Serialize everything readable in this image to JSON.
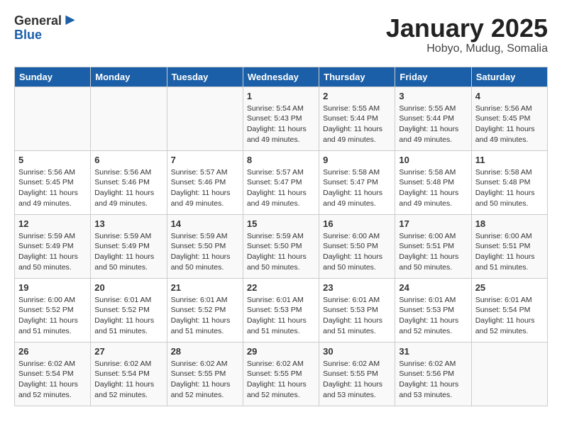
{
  "logo": {
    "general": "General",
    "blue": "Blue"
  },
  "title": "January 2025",
  "location": "Hobyo, Mudug, Somalia",
  "weekdays": [
    "Sunday",
    "Monday",
    "Tuesday",
    "Wednesday",
    "Thursday",
    "Friday",
    "Saturday"
  ],
  "weeks": [
    [
      {
        "day": "",
        "info": ""
      },
      {
        "day": "",
        "info": ""
      },
      {
        "day": "",
        "info": ""
      },
      {
        "day": "1",
        "info": "Sunrise: 5:54 AM\nSunset: 5:43 PM\nDaylight: 11 hours\nand 49 minutes."
      },
      {
        "day": "2",
        "info": "Sunrise: 5:55 AM\nSunset: 5:44 PM\nDaylight: 11 hours\nand 49 minutes."
      },
      {
        "day": "3",
        "info": "Sunrise: 5:55 AM\nSunset: 5:44 PM\nDaylight: 11 hours\nand 49 minutes."
      },
      {
        "day": "4",
        "info": "Sunrise: 5:56 AM\nSunset: 5:45 PM\nDaylight: 11 hours\nand 49 minutes."
      }
    ],
    [
      {
        "day": "5",
        "info": "Sunrise: 5:56 AM\nSunset: 5:45 PM\nDaylight: 11 hours\nand 49 minutes."
      },
      {
        "day": "6",
        "info": "Sunrise: 5:56 AM\nSunset: 5:46 PM\nDaylight: 11 hours\nand 49 minutes."
      },
      {
        "day": "7",
        "info": "Sunrise: 5:57 AM\nSunset: 5:46 PM\nDaylight: 11 hours\nand 49 minutes."
      },
      {
        "day": "8",
        "info": "Sunrise: 5:57 AM\nSunset: 5:47 PM\nDaylight: 11 hours\nand 49 minutes."
      },
      {
        "day": "9",
        "info": "Sunrise: 5:58 AM\nSunset: 5:47 PM\nDaylight: 11 hours\nand 49 minutes."
      },
      {
        "day": "10",
        "info": "Sunrise: 5:58 AM\nSunset: 5:48 PM\nDaylight: 11 hours\nand 49 minutes."
      },
      {
        "day": "11",
        "info": "Sunrise: 5:58 AM\nSunset: 5:48 PM\nDaylight: 11 hours\nand 50 minutes."
      }
    ],
    [
      {
        "day": "12",
        "info": "Sunrise: 5:59 AM\nSunset: 5:49 PM\nDaylight: 11 hours\nand 50 minutes."
      },
      {
        "day": "13",
        "info": "Sunrise: 5:59 AM\nSunset: 5:49 PM\nDaylight: 11 hours\nand 50 minutes."
      },
      {
        "day": "14",
        "info": "Sunrise: 5:59 AM\nSunset: 5:50 PM\nDaylight: 11 hours\nand 50 minutes."
      },
      {
        "day": "15",
        "info": "Sunrise: 5:59 AM\nSunset: 5:50 PM\nDaylight: 11 hours\nand 50 minutes."
      },
      {
        "day": "16",
        "info": "Sunrise: 6:00 AM\nSunset: 5:50 PM\nDaylight: 11 hours\nand 50 minutes."
      },
      {
        "day": "17",
        "info": "Sunrise: 6:00 AM\nSunset: 5:51 PM\nDaylight: 11 hours\nand 50 minutes."
      },
      {
        "day": "18",
        "info": "Sunrise: 6:00 AM\nSunset: 5:51 PM\nDaylight: 11 hours\nand 51 minutes."
      }
    ],
    [
      {
        "day": "19",
        "info": "Sunrise: 6:00 AM\nSunset: 5:52 PM\nDaylight: 11 hours\nand 51 minutes."
      },
      {
        "day": "20",
        "info": "Sunrise: 6:01 AM\nSunset: 5:52 PM\nDaylight: 11 hours\nand 51 minutes."
      },
      {
        "day": "21",
        "info": "Sunrise: 6:01 AM\nSunset: 5:52 PM\nDaylight: 11 hours\nand 51 minutes."
      },
      {
        "day": "22",
        "info": "Sunrise: 6:01 AM\nSunset: 5:53 PM\nDaylight: 11 hours\nand 51 minutes."
      },
      {
        "day": "23",
        "info": "Sunrise: 6:01 AM\nSunset: 5:53 PM\nDaylight: 11 hours\nand 51 minutes."
      },
      {
        "day": "24",
        "info": "Sunrise: 6:01 AM\nSunset: 5:53 PM\nDaylight: 11 hours\nand 52 minutes."
      },
      {
        "day": "25",
        "info": "Sunrise: 6:01 AM\nSunset: 5:54 PM\nDaylight: 11 hours\nand 52 minutes."
      }
    ],
    [
      {
        "day": "26",
        "info": "Sunrise: 6:02 AM\nSunset: 5:54 PM\nDaylight: 11 hours\nand 52 minutes."
      },
      {
        "day": "27",
        "info": "Sunrise: 6:02 AM\nSunset: 5:54 PM\nDaylight: 11 hours\nand 52 minutes."
      },
      {
        "day": "28",
        "info": "Sunrise: 6:02 AM\nSunset: 5:55 PM\nDaylight: 11 hours\nand 52 minutes."
      },
      {
        "day": "29",
        "info": "Sunrise: 6:02 AM\nSunset: 5:55 PM\nDaylight: 11 hours\nand 52 minutes."
      },
      {
        "day": "30",
        "info": "Sunrise: 6:02 AM\nSunset: 5:55 PM\nDaylight: 11 hours\nand 53 minutes."
      },
      {
        "day": "31",
        "info": "Sunrise: 6:02 AM\nSunset: 5:56 PM\nDaylight: 11 hours\nand 53 minutes."
      },
      {
        "day": "",
        "info": ""
      }
    ]
  ]
}
